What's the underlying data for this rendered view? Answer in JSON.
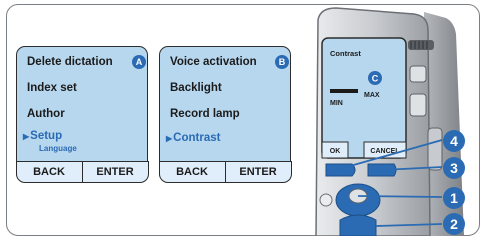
{
  "screen_a": {
    "badge": "A",
    "items": [
      "Delete dictation",
      "Index set",
      "Author",
      "Setup"
    ],
    "selected_sub": "Language",
    "softkey_left": "BACK",
    "softkey_right": "ENTER"
  },
  "screen_b": {
    "badge": "B",
    "items": [
      "Voice activation",
      "Backlight",
      "Record lamp",
      "Contrast"
    ],
    "softkey_left": "BACK",
    "softkey_right": "ENTER"
  },
  "device": {
    "screen_title": "Contrast",
    "badge": "C",
    "min_label": "MIN",
    "max_label": "MAX",
    "ok_label": "OK",
    "cancel_label": "CANCEL"
  },
  "callouts": [
    "1",
    "2",
    "3",
    "4"
  ],
  "colors": {
    "accent": "#2a6bb3",
    "lcd": "#b7d7ef",
    "softkey": "#dfeefa",
    "frame": "#7a7f84"
  }
}
